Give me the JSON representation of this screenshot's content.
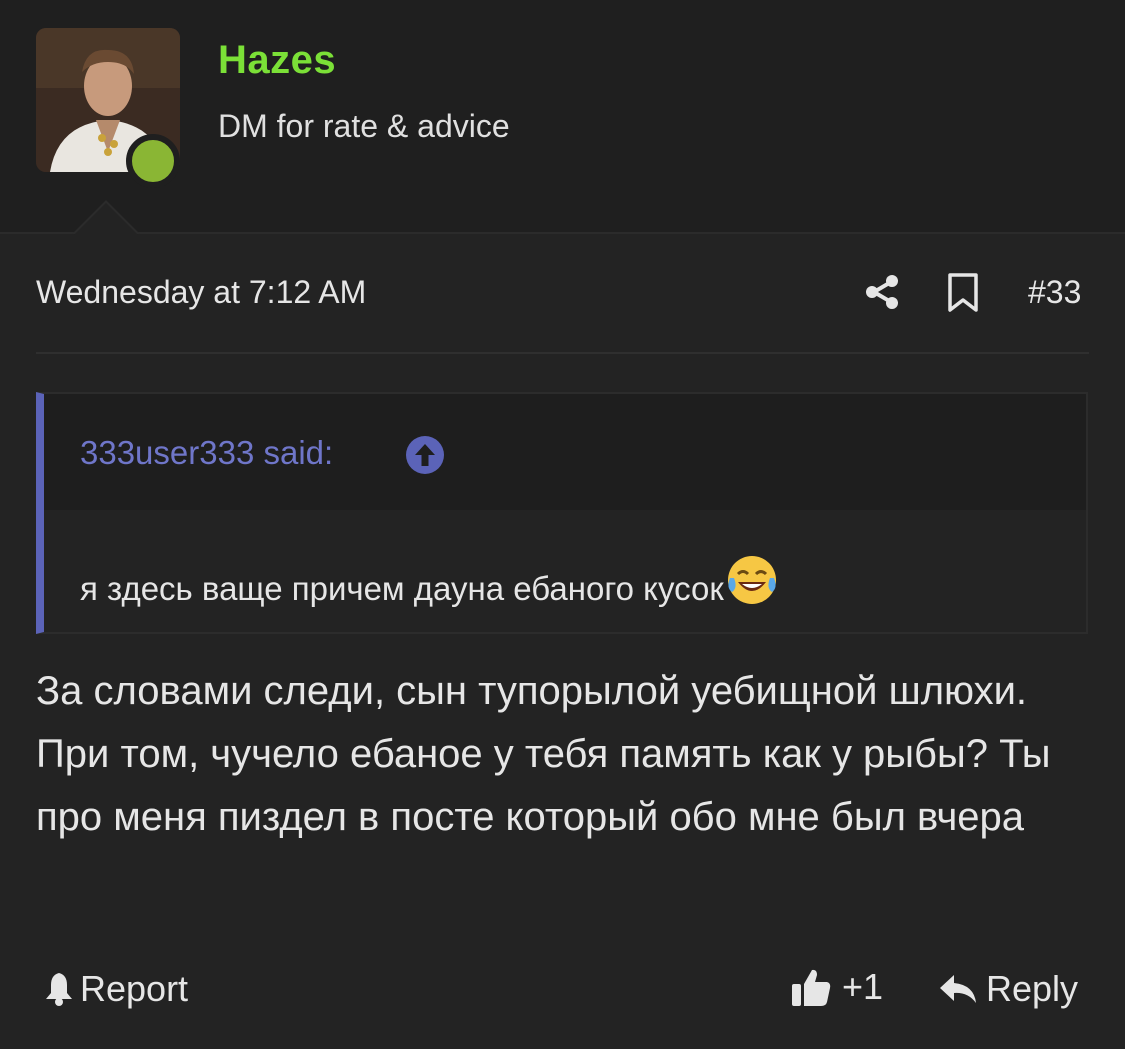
{
  "user": {
    "name": "Hazes",
    "title": "DM for rate & advice",
    "online": true
  },
  "post": {
    "date": "Wednesday at 7:12 AM",
    "number": "#33"
  },
  "quote": {
    "author_label": "333user333 said:",
    "text": "я здесь ваще причем дауна ебаного кусок",
    "emoji_icon": "face-with-tears-of-joy-icon"
  },
  "message": "За словами следи, сын тупорылой уебищной шлюхи. При том, чучело ебаное у тебя память как у рыбы? Ты про меня пиздел в посте который обо мне был вчера",
  "actions": {
    "report_label": "Report",
    "like_count": "+1",
    "reply_label": "Reply"
  },
  "colors": {
    "username": "#7be037",
    "online": "#8ab634",
    "quote_accent": "#5b63b8",
    "background": "#232323"
  }
}
